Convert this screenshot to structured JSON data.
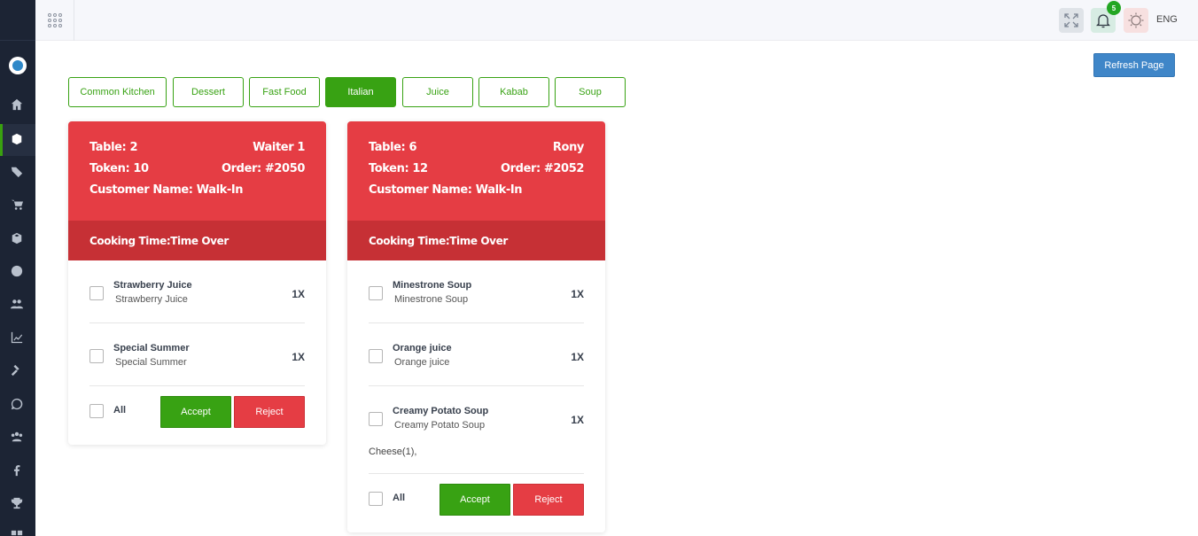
{
  "header": {
    "language": "ENG",
    "notification_count": "5"
  },
  "refresh_label": "Refresh Page",
  "tabs": [
    {
      "label": "Common Kitchen"
    },
    {
      "label": "Dessert"
    },
    {
      "label": "Fast Food"
    },
    {
      "label": "Italian",
      "active": true
    },
    {
      "label": "Juice"
    },
    {
      "label": "Kabab"
    },
    {
      "label": "Soup"
    }
  ],
  "orders": [
    {
      "table": "Table: 2",
      "waiter": "Waiter 1",
      "token": "Token: 10",
      "order": "Order: #2050",
      "customer": "Customer Name: Walk-In",
      "cooking_time": "Cooking Time:Time Over",
      "items": [
        {
          "name": "Strawberry Juice",
          "sub": "Strawberry Juice",
          "qty": "1X"
        },
        {
          "name": "Special Summer",
          "sub": "Special Summer",
          "qty": "1X"
        }
      ],
      "all_label": "All",
      "accept_label": "Accept",
      "reject_label": "Reject"
    },
    {
      "table": "Table: 6",
      "waiter": "Rony",
      "token": "Token: 12",
      "order": "Order: #2052",
      "customer": "Customer Name: Walk-In",
      "cooking_time": "Cooking Time:Time Over",
      "items": [
        {
          "name": "Minestrone Soup",
          "sub": "Minestrone Soup",
          "qty": "1X"
        },
        {
          "name": "Orange juice",
          "sub": "Orange juice",
          "qty": "1X"
        },
        {
          "name": "Creamy Potato Soup",
          "sub": "Creamy Potato Soup",
          "qty": "1X"
        }
      ],
      "addon": "Cheese(1),",
      "all_label": "All",
      "accept_label": "Accept",
      "reject_label": "Reject"
    }
  ],
  "sidebar_icons": [
    "logo-icon",
    "home-icon",
    "box-icon",
    "tags-icon",
    "cart-icon",
    "package-icon",
    "parking-icon",
    "users-icon",
    "chart-icon",
    "gavel-icon",
    "whatsapp-icon",
    "group-icon",
    "facebook-icon",
    "trophy-icon",
    "grid-icon"
  ],
  "colors": {
    "primary_green": "#38a213",
    "danger_red": "#e53d44",
    "dark_red": "#c63035",
    "sidebar": "#1c2434",
    "refresh_blue": "#3f86c8"
  }
}
